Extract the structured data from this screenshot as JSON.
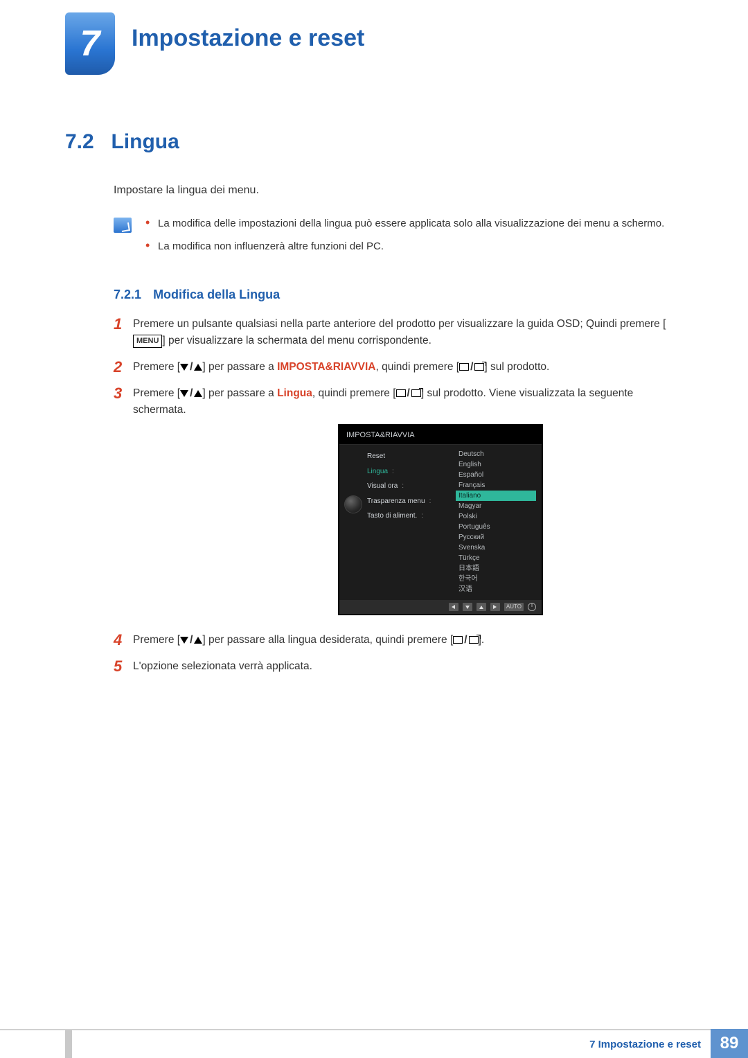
{
  "chapter": {
    "number": "7",
    "title": "Impostazione e reset"
  },
  "section": {
    "number": "7.2",
    "title": "Lingua"
  },
  "intro": "Impostare la lingua dei menu.",
  "notes": [
    "La modifica delle impostazioni della lingua può essere applicata solo alla visualizzazione dei menu a schermo.",
    "La modifica non influenzerà altre funzioni del PC."
  ],
  "subsection": {
    "number": "7.2.1",
    "title": "Modifica della Lingua"
  },
  "steps": {
    "s1a": "Premere un pulsante qualsiasi nella parte anteriore del prodotto per visualizzare la guida OSD; Quindi premere [",
    "s1b": "] per visualizzare la schermata del menu corrispondente.",
    "menu_label": "MENU",
    "s2a": "Premere [",
    "s2b": "] per passare a ",
    "s2_accent": "IMPOSTA&RIAVVIA",
    "s2c": ", quindi premere [",
    "s2d": "] sul prodotto.",
    "s3a": "Premere [",
    "s3b": "] per passare a ",
    "s3_accent": "Lingua",
    "s3c": ", quindi premere [",
    "s3d": "] sul prodotto. Viene visualizzata la seguente schermata.",
    "s4a": "Premere [",
    "s4b": "] per passare alla lingua desiderata, quindi premere [",
    "s4c": "].",
    "s5": "L'opzione selezionata verrà applicata."
  },
  "osd": {
    "title": "IMPOSTA&RIAVVIA",
    "menu": [
      "Reset",
      "Lingua",
      "Visual ora",
      "Trasparenza menu",
      "Tasto di aliment."
    ],
    "selected_menu_index": 1,
    "languages": [
      "Deutsch",
      "English",
      "Español",
      "Français",
      "Italiano",
      "Magyar",
      "Polski",
      "Português",
      "Русский",
      "Svenska",
      "Türkçe",
      "日本語",
      "한국어",
      "汉语"
    ],
    "selected_lang_index": 4,
    "auto_label": "AUTO"
  },
  "footer": {
    "text": "7 Impostazione e reset",
    "page": "89"
  }
}
